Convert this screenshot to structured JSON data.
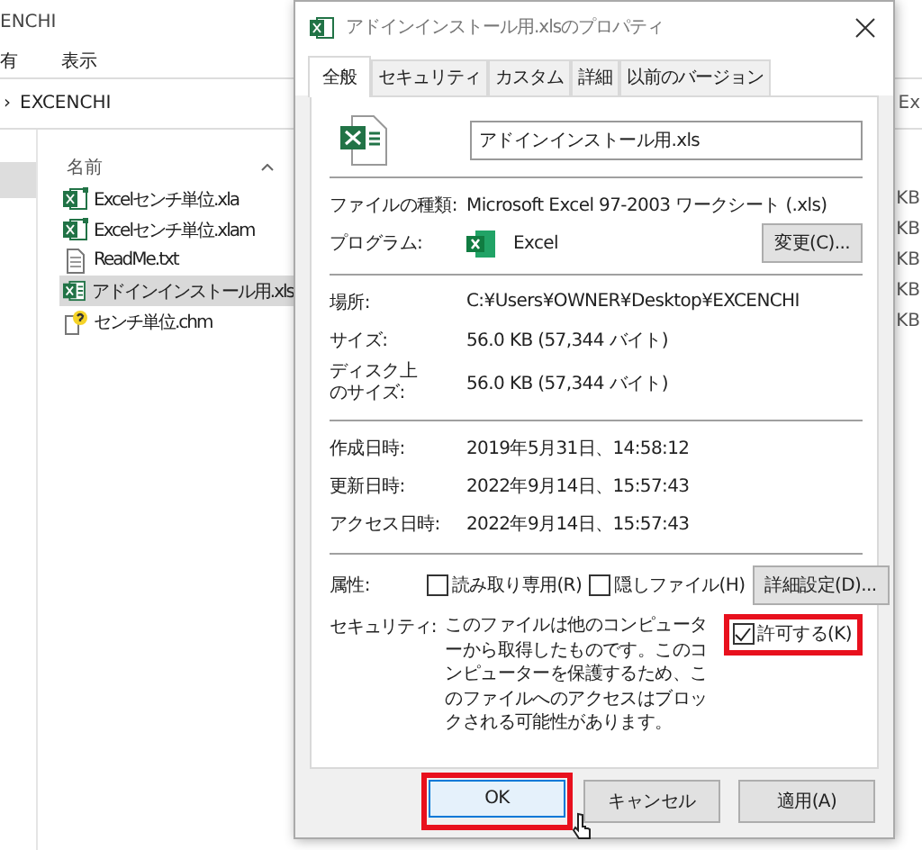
{
  "explorer": {
    "title": "ENCHI",
    "menu": [
      "有",
      "表示"
    ],
    "breadcrumb": {
      "separator": "›",
      "folder": "EXCENCHI"
    },
    "search_placeholder": "Ex",
    "column_header": "名前",
    "files": [
      {
        "name": "Excelセンチ単位.xla",
        "kind": "excel",
        "selected": false,
        "size": "KB"
      },
      {
        "name": "Excelセンチ単位.xlam",
        "kind": "excel",
        "selected": false,
        "size": "KB"
      },
      {
        "name": "ReadMe.txt",
        "kind": "text",
        "selected": false,
        "size": "KB"
      },
      {
        "name": "アドインインストール用.xls",
        "kind": "sheet",
        "selected": true,
        "size": "KB"
      },
      {
        "name": "センチ単位.chm",
        "kind": "help",
        "selected": false,
        "size": "KB"
      }
    ]
  },
  "dialog": {
    "title": "アドインインストール用.xlsのプロパティ",
    "tabs": [
      {
        "label": "全般",
        "selected": true
      },
      {
        "label": "セキュリティ",
        "selected": false
      },
      {
        "label": "カスタム",
        "selected": false
      },
      {
        "label": "詳細",
        "selected": false
      },
      {
        "label": "以前のバージョン",
        "selected": false
      }
    ],
    "file_name": "アドインインストール用.xls",
    "type": {
      "label": "ファイルの種類:",
      "value": "Microsoft Excel 97-2003 ワークシート (.xls)"
    },
    "program": {
      "label": "プログラム:",
      "value": "Excel",
      "button": "変更(C)..."
    },
    "location": {
      "label": "場所:",
      "value": "C:¥Users¥OWNER¥Desktop¥EXCENCHI"
    },
    "size": {
      "label": "サイズ:",
      "value": "56.0 KB (57,344 バイト)"
    },
    "disk_size": {
      "label": "ディスク上のサイズ:",
      "value": "56.0 KB (57,344 バイト)"
    },
    "dates": [
      {
        "label": "作成日時:",
        "value": "2019年5月31日、14:58:12"
      },
      {
        "label": "更新日時:",
        "value": "2022年9月14日、15:57:43"
      },
      {
        "label": "アクセス日時:",
        "value": "2022年9月14日、15:57:43"
      }
    ],
    "attributes": {
      "label": "属性:",
      "checkboxes": [
        {
          "label": "読み取り専用(R)",
          "checked": false
        },
        {
          "label": "隠しファイル(H)",
          "checked": false
        }
      ],
      "button": "詳細設定(D)..."
    },
    "security": {
      "label": "セキュリティ:",
      "text": "このファイルは他のコンピューターから取得したものです。このコンピューターを保護するため、このファイルへのアクセスはブロックされる可能性があります。",
      "checkbox": {
        "label": "許可する(K)",
        "checked": true,
        "highlighted": true
      }
    },
    "buttons": [
      {
        "label": "OK",
        "default": true,
        "highlighted": true
      },
      {
        "label": "キャンセル",
        "default": false,
        "highlighted": false
      },
      {
        "label": "適用(A)",
        "default": false,
        "highlighted": false
      }
    ]
  }
}
